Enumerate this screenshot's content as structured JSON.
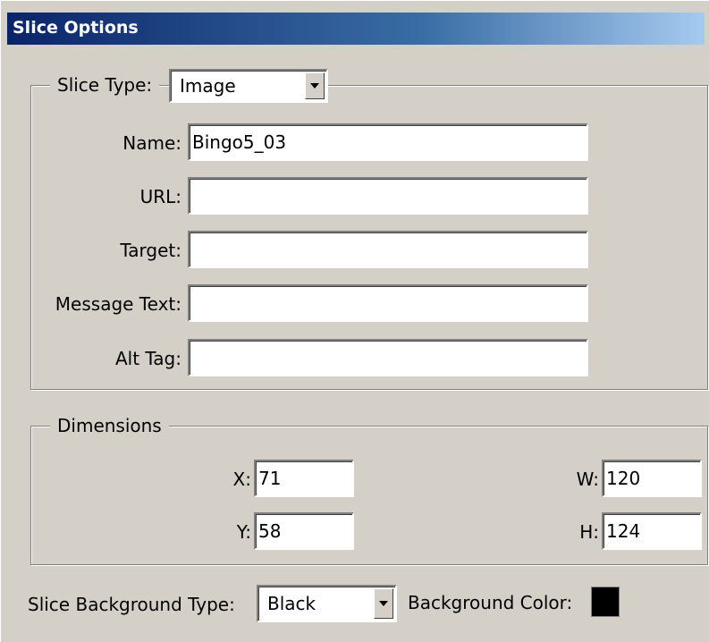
{
  "window": {
    "title": "Slice Options"
  },
  "slice_type": {
    "label": "Slice Type:",
    "value": "Image"
  },
  "fields": {
    "name": {
      "label": "Name:",
      "value": "Bingo5_03"
    },
    "url": {
      "label": "URL:",
      "value": ""
    },
    "target": {
      "label": "Target:",
      "value": ""
    },
    "message_text": {
      "label": "Message Text:",
      "value": ""
    },
    "alt_tag": {
      "label": "Alt Tag:",
      "value": ""
    }
  },
  "dimensions": {
    "label": "Dimensions",
    "x": {
      "label": "X:",
      "value": "71"
    },
    "y": {
      "label": "Y:",
      "value": "58"
    },
    "w": {
      "label": "W:",
      "value": "120"
    },
    "h": {
      "label": "H:",
      "value": "124"
    }
  },
  "background": {
    "type_label": "Slice Background Type:",
    "type_value": "Black",
    "color_label": "Background Color:",
    "color": "#000000"
  }
}
